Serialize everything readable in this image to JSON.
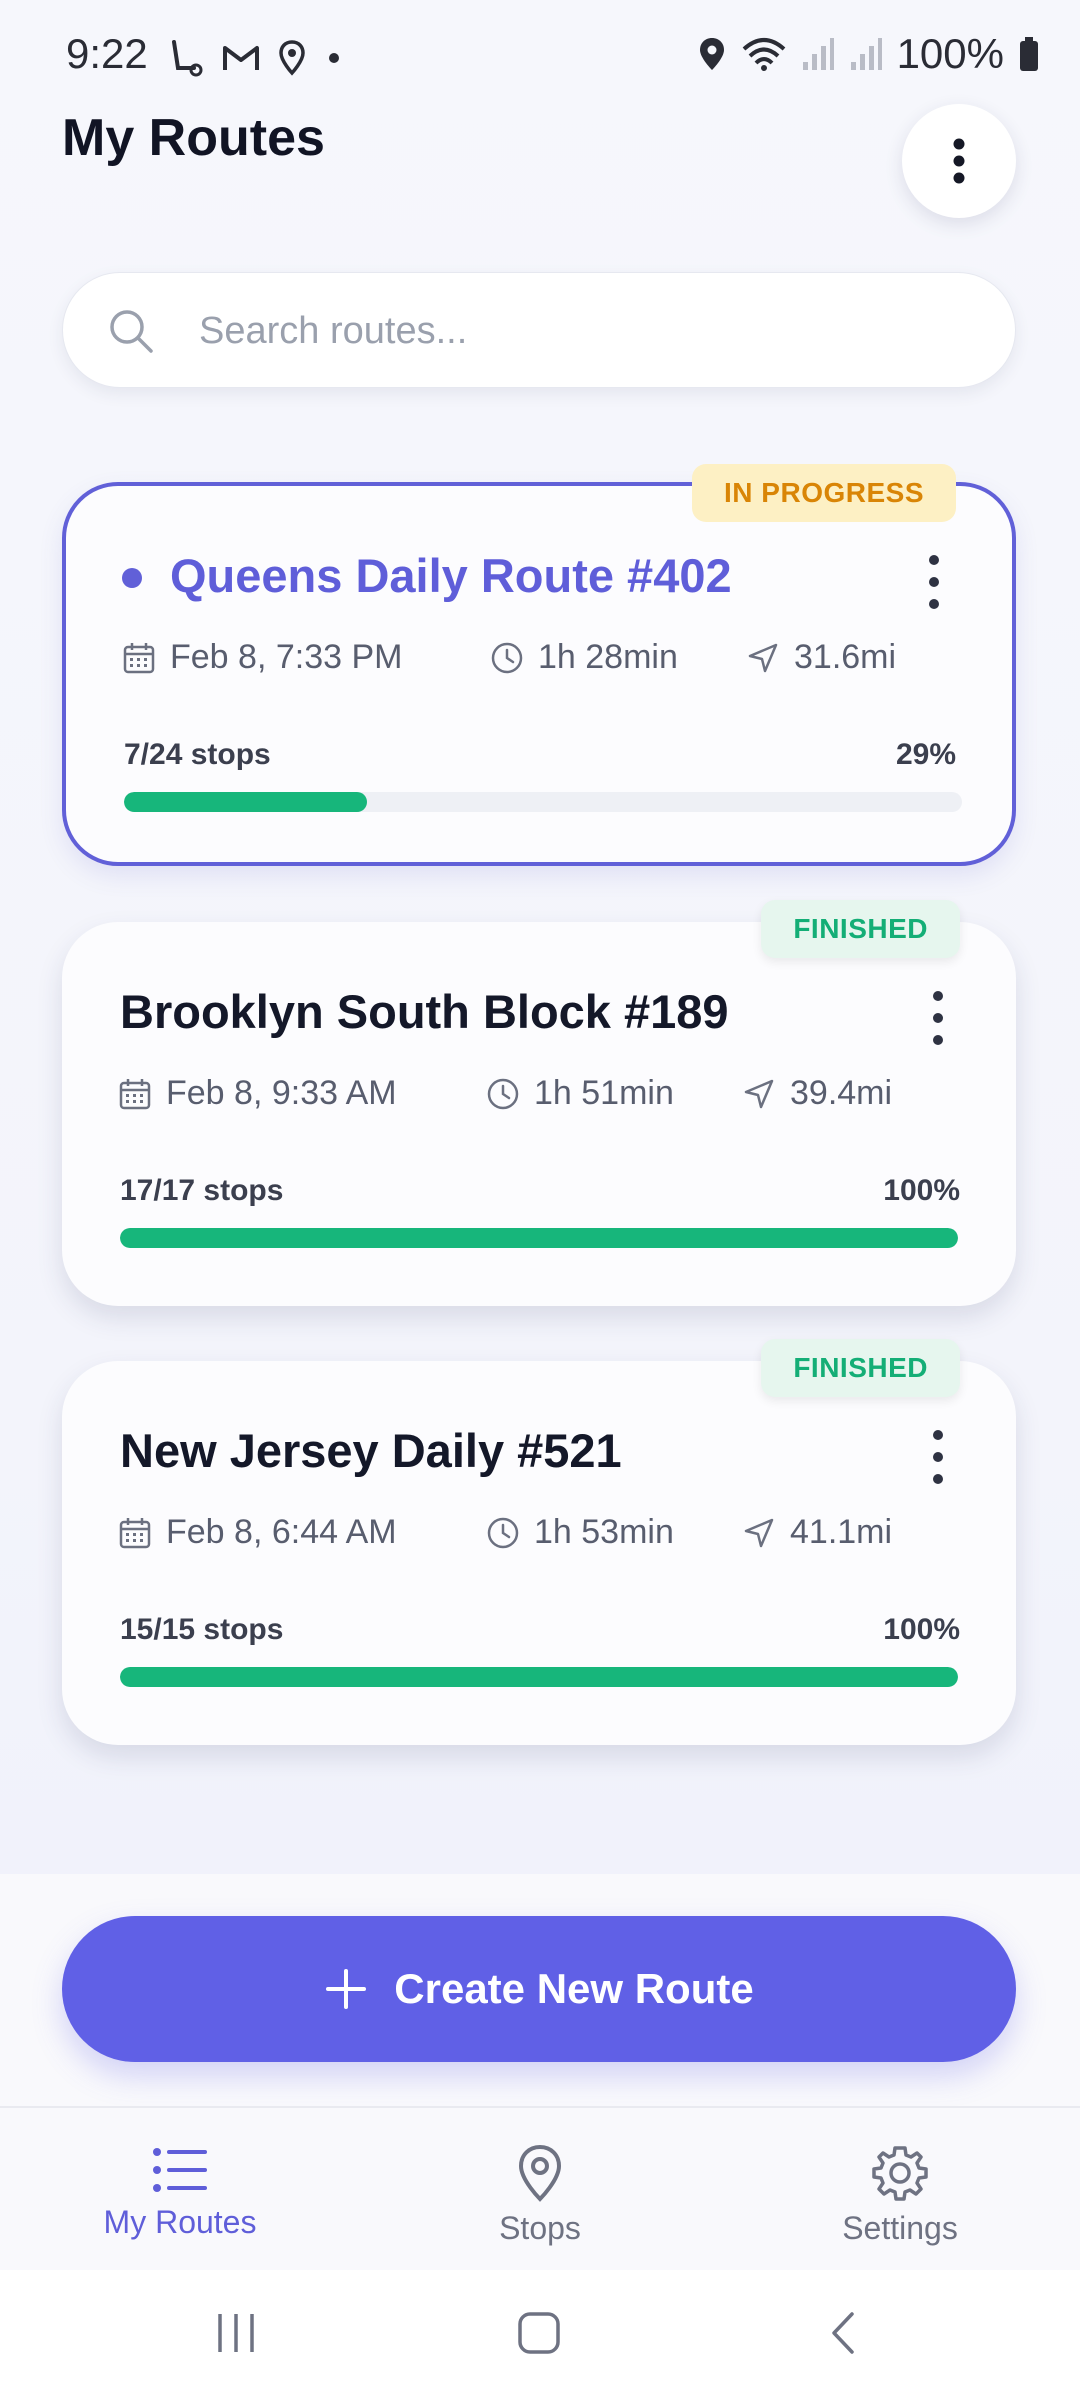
{
  "status_bar": {
    "time": "9:22",
    "battery": "100%"
  },
  "header": {
    "title": "My Routes"
  },
  "search": {
    "placeholder": "Search routes..."
  },
  "routes": [
    {
      "title": "Queens Daily Route #402",
      "status": "IN PROGRESS",
      "date": "Feb 8, 7:33 PM",
      "duration": "1h 28min",
      "distance": "31.6mi",
      "stops": "7/24 stops",
      "percent_label": "29%",
      "progress": 0.29
    },
    {
      "title": "Brooklyn South Block #189",
      "status": "FINISHED",
      "date": "Feb 8, 9:33 AM",
      "duration": "1h 51min",
      "distance": "39.4mi",
      "stops": "17/17 stops",
      "percent_label": "100%",
      "progress": 1.0
    },
    {
      "title": "New Jersey Daily #521",
      "status": "FINISHED",
      "date": "Feb 8, 6:44 AM",
      "duration": "1h 53min",
      "distance": "41.1mi",
      "stops": "15/15 stops",
      "percent_label": "100%",
      "progress": 1.0
    }
  ],
  "create_button": {
    "label": "Create New Route"
  },
  "bottom_nav": {
    "items": [
      {
        "label": "My Routes",
        "icon": "list-icon",
        "active": true
      },
      {
        "label": "Stops",
        "icon": "map-pin-icon",
        "active": false
      },
      {
        "label": "Settings",
        "icon": "gear-icon",
        "active": false
      }
    ]
  },
  "colors": {
    "accent": "#6060e6",
    "progress_green": "#17b67b",
    "in_progress_badge": "#fdf0c4",
    "finished_badge": "#e6f6ee"
  }
}
